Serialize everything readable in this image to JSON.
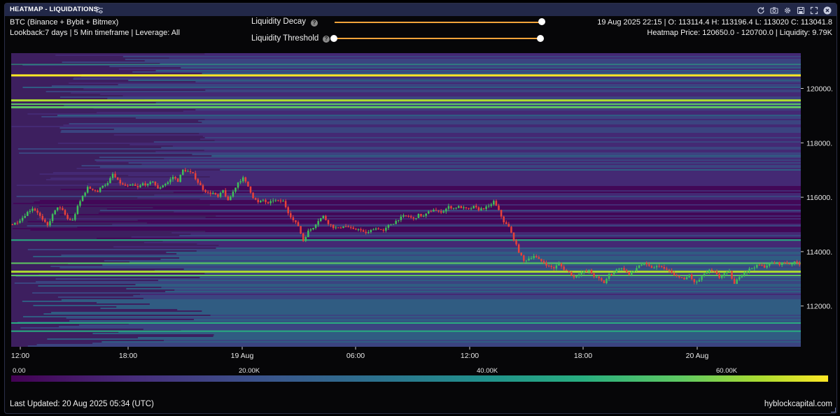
{
  "window": {
    "title": "HEATMAP - LIQUIDATIONS",
    "icons": [
      "refresh-icon",
      "camera-icon",
      "gear-icon",
      "save-icon",
      "expand-icon",
      "close-icon"
    ]
  },
  "info": {
    "symbol": "BTC (Binance + Bybit + Bitmex)",
    "params": "Lookback:7 days | 5 Min timeframe | Leverage: All",
    "ohlc": "19 Aug 2025 22:15 | O: 113114.4 H: 113196.4 L: 113020 C: 113041.8",
    "heatmap": "Heatmap Price: 120650.0 - 120700.0 | Liquidity: 9.79K"
  },
  "controls": {
    "decay_label": "Liquidity Decay",
    "threshold_label": "Liquidity Threshold",
    "decay_value": 1.0,
    "threshold_value": 0.0,
    "help_glyph": "?"
  },
  "chart": {
    "y_ticks": [
      "120000.0",
      "118000.0",
      "116000.0",
      "114000.0",
      "112000.0"
    ],
    "x_ticks": [
      "12:00",
      "18:00",
      "19 Aug",
      "06:00",
      "12:00",
      "18:00",
      "20 Aug"
    ],
    "price_min": 110500,
    "price_max": 121300,
    "candle_path": [
      [
        0,
        115000
      ],
      [
        2,
        115100
      ],
      [
        4,
        115250
      ],
      [
        6,
        115450
      ],
      [
        8,
        115600
      ],
      [
        10,
        115450
      ],
      [
        12,
        115150
      ],
      [
        14,
        114950
      ],
      [
        16,
        115350
      ],
      [
        18,
        115650
      ],
      [
        20,
        115500
      ],
      [
        22,
        115200
      ],
      [
        24,
        115150
      ],
      [
        26,
        115650
      ],
      [
        28,
        116050
      ],
      [
        30,
        116350
      ],
      [
        32,
        116300
      ],
      [
        34,
        116200
      ],
      [
        36,
        116450
      ],
      [
        38,
        116500
      ],
      [
        40,
        116850
      ],
      [
        42,
        116600
      ],
      [
        44,
        116450
      ],
      [
        46,
        116400
      ],
      [
        48,
        116450
      ],
      [
        50,
        116350
      ],
      [
        52,
        116500
      ],
      [
        54,
        116450
      ],
      [
        56,
        116600
      ],
      [
        58,
        116300
      ],
      [
        60,
        116450
      ],
      [
        62,
        116550
      ],
      [
        64,
        116750
      ],
      [
        66,
        116600
      ],
      [
        68,
        117000
      ],
      [
        70,
        116950
      ],
      [
        72,
        116850
      ],
      [
        74,
        116550
      ],
      [
        76,
        116300
      ],
      [
        78,
        116150
      ],
      [
        80,
        116150
      ],
      [
        82,
        116000
      ],
      [
        84,
        116250
      ],
      [
        86,
        115850
      ],
      [
        88,
        116200
      ],
      [
        90,
        116550
      ],
      [
        92,
        116700
      ],
      [
        94,
        116400
      ],
      [
        96,
        116000
      ],
      [
        98,
        115800
      ],
      [
        100,
        115900
      ],
      [
        102,
        115750
      ],
      [
        104,
        115900
      ],
      [
        106,
        115850
      ],
      [
        108,
        115850
      ],
      [
        110,
        115450
      ],
      [
        112,
        115150
      ],
      [
        114,
        114950
      ],
      [
        116,
        114400
      ],
      [
        118,
        114750
      ],
      [
        120,
        114900
      ],
      [
        122,
        115150
      ],
      [
        124,
        115300
      ],
      [
        126,
        115050
      ],
      [
        128,
        114900
      ],
      [
        130,
        114850
      ],
      [
        132,
        114950
      ],
      [
        134,
        114900
      ],
      [
        136,
        114800
      ],
      [
        138,
        114850
      ],
      [
        140,
        114700
      ],
      [
        142,
        114700
      ],
      [
        144,
        114850
      ],
      [
        146,
        114850
      ],
      [
        148,
        114750
      ],
      [
        150,
        114950
      ],
      [
        152,
        115050
      ],
      [
        154,
        115200
      ],
      [
        156,
        115300
      ],
      [
        158,
        115300
      ],
      [
        160,
        115200
      ],
      [
        162,
        115350
      ],
      [
        164,
        115300
      ],
      [
        166,
        115450
      ],
      [
        168,
        115550
      ],
      [
        170,
        115450
      ],
      [
        172,
        115500
      ],
      [
        174,
        115650
      ],
      [
        176,
        115600
      ],
      [
        178,
        115650
      ],
      [
        180,
        115600
      ],
      [
        182,
        115550
      ],
      [
        184,
        115650
      ],
      [
        186,
        115550
      ],
      [
        188,
        115600
      ],
      [
        190,
        115650
      ],
      [
        192,
        115850
      ],
      [
        194,
        115500
      ],
      [
        196,
        115100
      ],
      [
        198,
        114900
      ],
      [
        200,
        114450
      ],
      [
        202,
        114000
      ],
      [
        204,
        113650
      ],
      [
        206,
        113750
      ],
      [
        208,
        113850
      ],
      [
        210,
        113700
      ],
      [
        212,
        113600
      ],
      [
        214,
        113450
      ],
      [
        216,
        113400
      ],
      [
        218,
        113550
      ],
      [
        220,
        113350
      ],
      [
        222,
        113250
      ],
      [
        224,
        113050
      ],
      [
        226,
        113200
      ],
      [
        228,
        113250
      ],
      [
        230,
        113300
      ],
      [
        232,
        113100
      ],
      [
        234,
        113000
      ],
      [
        236,
        112850
      ],
      [
        238,
        113150
      ],
      [
        240,
        113250
      ],
      [
        242,
        113400
      ],
      [
        244,
        113350
      ],
      [
        246,
        113150
      ],
      [
        248,
        113300
      ],
      [
        250,
        113500
      ],
      [
        252,
        113550
      ],
      [
        254,
        113450
      ],
      [
        256,
        113400
      ],
      [
        258,
        113500
      ],
      [
        260,
        113350
      ],
      [
        262,
        113300
      ],
      [
        264,
        113100
      ],
      [
        266,
        113100
      ],
      [
        268,
        112950
      ],
      [
        270,
        113150
      ],
      [
        272,
        112850
      ],
      [
        274,
        112950
      ],
      [
        276,
        113200
      ],
      [
        278,
        113300
      ],
      [
        280,
        113250
      ],
      [
        282,
        113050
      ],
      [
        284,
        113200
      ],
      [
        286,
        113250
      ],
      [
        288,
        112800
      ],
      [
        290,
        113100
      ],
      [
        292,
        113250
      ],
      [
        294,
        113350
      ],
      [
        296,
        113450
      ],
      [
        298,
        113500
      ],
      [
        300,
        113450
      ],
      [
        302,
        113550
      ],
      [
        304,
        113600
      ],
      [
        306,
        113550
      ],
      [
        308,
        113600
      ],
      [
        310,
        113550
      ],
      [
        312,
        113600
      ],
      [
        314,
        113550
      ]
    ],
    "candle_up_color": "#3fbf5a",
    "candle_down_color": "#e8413a",
    "colormap": [
      "#440154",
      "#472d7b",
      "#3b528b",
      "#2c728e",
      "#21918c",
      "#28ae80",
      "#5ec962",
      "#addc30",
      "#fde725"
    ]
  },
  "colorbar": {
    "labels": [
      "0.00",
      "20.00K",
      "40.00K",
      "60.00K"
    ]
  },
  "footer": {
    "updated": "Last Updated: 20 Aug 2025 05:34 (UTC)",
    "brand": "hyblockcapital.com"
  }
}
